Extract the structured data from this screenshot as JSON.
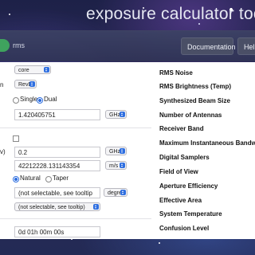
{
  "app": {
    "title": "exposure calculator tool"
  },
  "nav": {
    "rms_label": "rms",
    "documentation_label": "Documentation",
    "help_label": "Help"
  },
  "inputs": {
    "config_select": "core",
    "revision_select": "RevD",
    "revision_prefix": "n",
    "mode_single": "Single",
    "mode_dual": "Dual",
    "frequency_value": "1.420405751",
    "frequency_unit": "GHz",
    "bandwidth_prefix": "v)",
    "bandwidth_value": "0.2",
    "bandwidth_unit": "GHz",
    "resolution_value": "42212228.131143354",
    "resolution_unit": "m/s",
    "weighting_natural": "Natural",
    "weighting_taper": "Taper",
    "taper_field": "(not selectable, see tooltip",
    "taper_unit": "degree",
    "taper_select": "(not selectable, see tooltip)",
    "time_value": "0d 01h 00m 00s"
  },
  "results": {
    "labels": [
      "RMS Noise",
      "RMS Brightness (Temp)",
      "Synthesized Beam Size",
      "Number of Antennas",
      "Receiver Band",
      "Maximum Instantaneous Bandwidth",
      "Digital Samplers",
      "Field of View",
      "Aperture Efficiency",
      "Effective Area",
      "System Temperature",
      "Confusion Level"
    ]
  },
  "colors": {
    "accent_blue": "#2f6fe0",
    "logo_green": "#3fa35e",
    "navbar": "#3c4264"
  }
}
